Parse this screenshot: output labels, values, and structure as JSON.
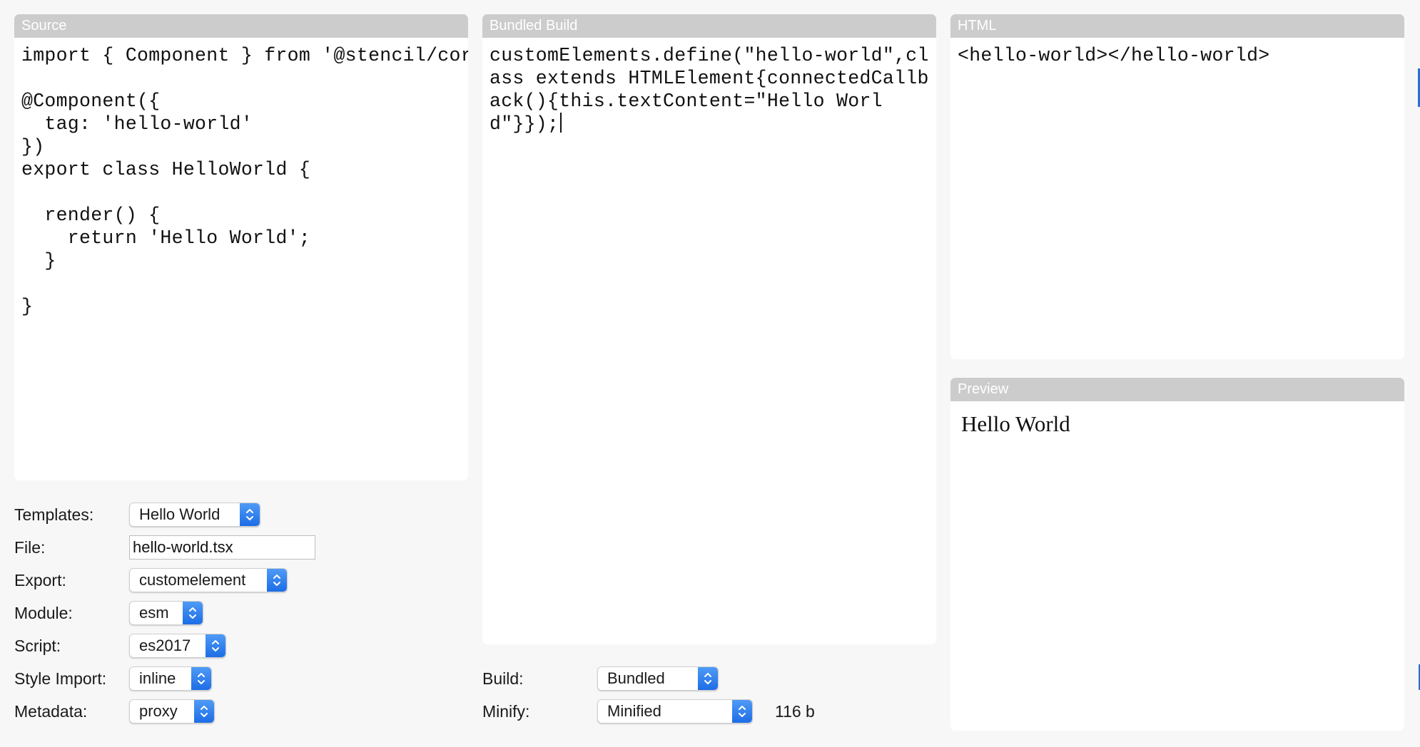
{
  "panels": {
    "source": {
      "title": "Source",
      "code": "import { Component } from '@stencil/core';\n\n@Component({\n  tag: 'hello-world'\n})\nexport class HelloWorld {\n\n  render() {\n    return 'Hello World';\n  }\n\n}"
    },
    "bundled": {
      "title": "Bundled Build",
      "code": "customElements.define(\"hello-world\",class extends HTMLElement{connectedCallback(){this.textContent=\"Hello World\"}});"
    },
    "html": {
      "title": "HTML",
      "code": "<hello-world></hello-world>"
    },
    "preview": {
      "title": "Preview",
      "content": "Hello World"
    }
  },
  "form": {
    "templates": {
      "label": "Templates:",
      "value": "Hello World"
    },
    "file": {
      "label": "File:",
      "value": "hello-world.tsx"
    },
    "export": {
      "label": "Export:",
      "value": "customelement"
    },
    "module": {
      "label": "Module:",
      "value": "esm"
    },
    "script": {
      "label": "Script:",
      "value": "es2017"
    },
    "style_import": {
      "label": "Style Import:",
      "value": "inline"
    },
    "metadata": {
      "label": "Metadata:",
      "value": "proxy"
    }
  },
  "build_options": {
    "build": {
      "label": "Build:",
      "value": "Bundled"
    },
    "minify": {
      "label": "Minify:",
      "value": "Minified"
    },
    "size": "116 b"
  },
  "colors": {
    "accent": "#2f80f0",
    "panel_header": "#cccccc"
  }
}
